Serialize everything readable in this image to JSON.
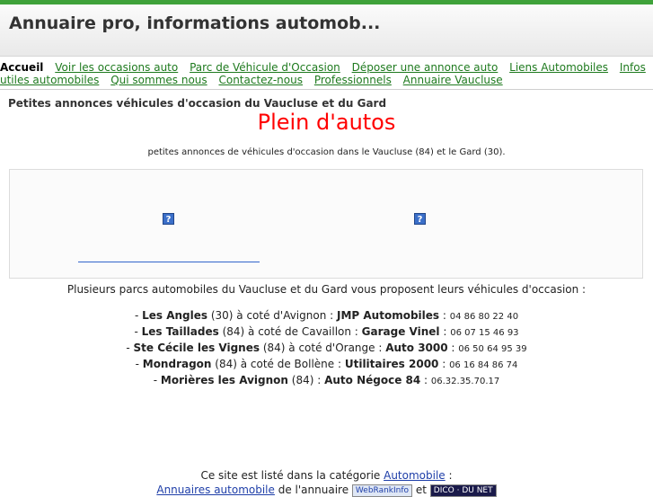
{
  "header": {
    "title": "Annuaire pro, informations automob..."
  },
  "nav": {
    "row1": [
      "Accueil",
      "Voir les occasions auto",
      "Parc de Véhicule d'Occasion",
      "Déposer une annonce auto",
      "Liens Automobiles",
      "Infos"
    ],
    "row2": [
      "utiles automobiles",
      "Qui sommes nous",
      "Contactez-nous",
      "Professionnels",
      "Annuaire Vaucluse"
    ]
  },
  "page": {
    "heading": "Petites annonces véhicules d'occasion du Vaucluse et du Gard",
    "brand": "Plein d'autos",
    "tagline": "petites annonces de véhicules d'occasion dans le Vaucluse (84) et le Gard (30).",
    "ad_icon": "?",
    "intro": "Plusieurs parcs automobiles du Vaucluse et du Gard vous proposent leurs véhicules d'occasion :"
  },
  "parks": [
    {
      "prefix": "- ",
      "town": "Les Angles",
      "dept": " (30) à coté d'Avignon : ",
      "garage": "JMP Automobiles",
      "sep": " : ",
      "phone": "04 86 80 22 40"
    },
    {
      "prefix": "- ",
      "town": "Les Taillades",
      "dept": " (84) à coté de Cavaillon : ",
      "garage": "Garage Vinel",
      "sep": " : ",
      "phone": "06 07 15 46 93"
    },
    {
      "prefix": "- ",
      "town": "Ste Cécile les Vignes",
      "dept": " (84) à coté d'Orange : ",
      "garage": "Auto 3000",
      "sep": " : ",
      "phone": "06 50 64 95 39"
    },
    {
      "prefix": "- ",
      "town": "Mondragon",
      "dept": " (84) à coté de Bollène : ",
      "garage": "Utilitaires 2000",
      "sep": " : ",
      "phone": "06 16 84 86 74"
    },
    {
      "prefix": "-  ",
      "town": "Morières les Avignon",
      "dept": " (84) : ",
      "garage": "Auto Négoce 84",
      "sep": " : ",
      "phone": "06.32.35.70.17"
    }
  ],
  "footer": {
    "line1_text": "Ce site est listé dans la catégorie ",
    "line1_link": "Automobile",
    "line1_end": " :",
    "line2_link": "Annuaires automobile",
    "line2_text": " de l'annuaire ",
    "badge1": "WebRankInfo",
    "line2_and": " et ",
    "badge2": "DICO · DU NET"
  }
}
